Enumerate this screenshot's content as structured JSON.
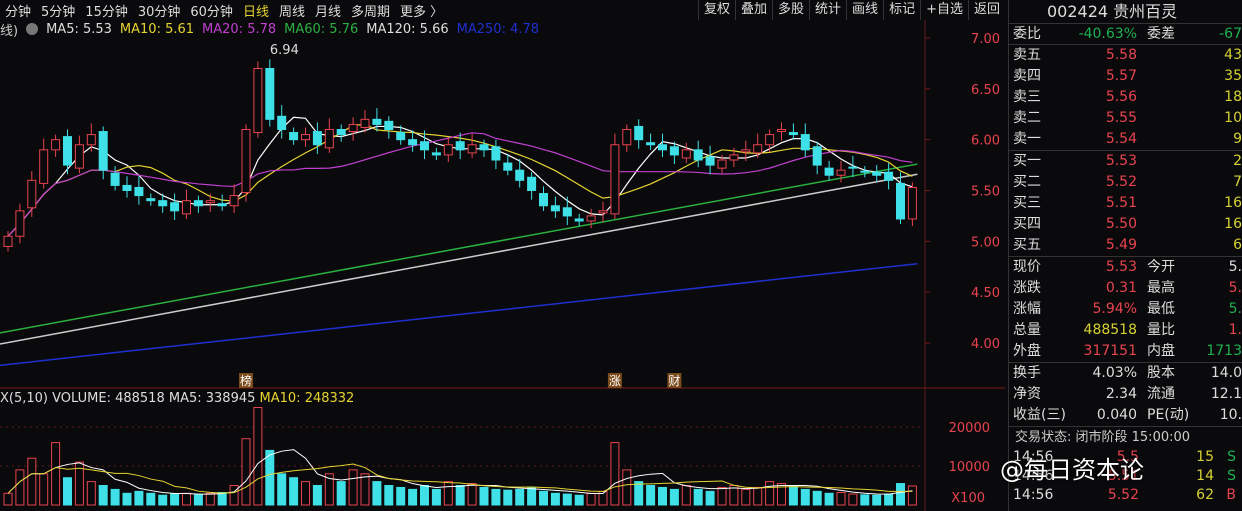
{
  "periods": [
    "分钟",
    "5分钟",
    "15分钟",
    "30分钟",
    "60分钟",
    "日线",
    "周线",
    "月线",
    "多周期",
    "更多 〉"
  ],
  "active_period": "日线",
  "tools": [
    "复权",
    "叠加",
    "多股",
    "统计",
    "画线",
    "标记",
    "+自选",
    "返回"
  ],
  "ma_header": {
    "prefix": "线)",
    "items": [
      {
        "label": "MA5: 5.53",
        "color": "#dddddd"
      },
      {
        "label": "MA10: 5.61",
        "color": "#e6d431"
      },
      {
        "label": "MA20: 5.78",
        "color": "#c040d0"
      },
      {
        "label": "MA60: 5.76",
        "color": "#2ab040"
      },
      {
        "label": "MA120: 5.66",
        "color": "#dddddd"
      },
      {
        "label": "MA250: 4.78",
        "color": "#2030d0"
      }
    ]
  },
  "price_labels": [
    "7.00",
    "6.50",
    "6.00",
    "5.50",
    "5.00",
    "4.50",
    "4.00"
  ],
  "high_label": "6.94",
  "markers": [
    {
      "text": "榜",
      "i": 20
    },
    {
      "text": "涨",
      "i": 51
    },
    {
      "text": "财",
      "i": 56
    }
  ],
  "volume_header": {
    "prefix": "X(5,10)",
    "volume": "VOLUME: 488518",
    "ma5": "MA5: 338945",
    "ma10": "MA10: 248332"
  },
  "volume_labels": [
    "20000",
    "10000",
    "X100"
  ],
  "chart_data": {
    "type": "candlestick",
    "ylim": [
      3.8,
      7.1
    ],
    "closes": [
      5.05,
      5.3,
      5.6,
      5.9,
      6.0,
      5.75,
      5.95,
      6.05,
      5.7,
      5.55,
      5.5,
      5.45,
      5.4,
      5.35,
      5.3,
      5.4,
      5.35,
      5.4,
      5.35,
      5.45,
      6.1,
      6.7,
      6.2,
      6.1,
      6.0,
      6.05,
      5.95,
      6.1,
      6.05,
      6.15,
      6.2,
      6.15,
      6.1,
      6.0,
      5.95,
      5.9,
      5.85,
      5.95,
      5.9,
      5.95,
      5.9,
      5.8,
      5.7,
      5.6,
      5.5,
      5.35,
      5.3,
      5.25,
      5.2,
      5.25,
      5.3,
      5.95,
      6.1,
      6.0,
      5.95,
      5.9,
      5.85,
      5.9,
      5.8,
      5.75,
      5.8,
      5.85,
      5.9,
      5.95,
      6.05,
      6.1,
      6.05,
      5.9,
      5.75,
      5.65,
      5.7,
      5.72,
      5.68,
      5.65,
      5.6,
      5.22,
      5.53
    ],
    "volumes": [
      3000,
      9000,
      12000,
      8000,
      16000,
      7000,
      11000,
      6000,
      5000,
      4000,
      3000,
      3500,
      3000,
      2500,
      2800,
      3000,
      2600,
      3000,
      3200,
      5000,
      17000,
      25000,
      14000,
      8000,
      7000,
      6000,
      5000,
      8000,
      6000,
      9000,
      8000,
      6000,
      5000,
      4500,
      4000,
      5000,
      4000,
      6000,
      5000,
      5500,
      4500,
      4000,
      3800,
      4000,
      4500,
      3500,
      3000,
      2800,
      2500,
      3000,
      3500,
      16000,
      9000,
      6000,
      5000,
      4500,
      4000,
      5000,
      4000,
      3500,
      4500,
      5000,
      4000,
      4500,
      6000,
      5500,
      5000,
      4000,
      3500,
      3000,
      3200,
      2800,
      2600,
      2500,
      2800,
      5500,
      4885
    ],
    "ma60": [
      4.1,
      5.76
    ],
    "ma120": [
      3.99,
      5.66
    ],
    "ma250": [
      3.78,
      4.78
    ]
  },
  "quote": {
    "code_name": "002424 贵州百灵",
    "wb_label": "委比",
    "wb": "-40.63%",
    "wc_label": "委差",
    "wc": "-67",
    "sells": [
      {
        "l": "卖五",
        "p": "5.58",
        "q": "43"
      },
      {
        "l": "卖四",
        "p": "5.57",
        "q": "35"
      },
      {
        "l": "卖三",
        "p": "5.56",
        "q": "18"
      },
      {
        "l": "卖二",
        "p": "5.55",
        "q": "10"
      },
      {
        "l": "卖一",
        "p": "5.54",
        "q": "9"
      }
    ],
    "buys": [
      {
        "l": "买一",
        "p": "5.53",
        "q": "2"
      },
      {
        "l": "买二",
        "p": "5.52",
        "q": "7"
      },
      {
        "l": "买三",
        "p": "5.51",
        "q": "16"
      },
      {
        "l": "买四",
        "p": "5.50",
        "q": "16"
      },
      {
        "l": "买五",
        "p": "5.49",
        "q": "6"
      }
    ],
    "stats": [
      {
        "l": "现价",
        "v": "5.53",
        "c": "red",
        "l2": "今开",
        "v2": "5.",
        "c2": "wht"
      },
      {
        "l": "涨跌",
        "v": "0.31",
        "c": "red",
        "l2": "最高",
        "v2": "5.",
        "c2": "red"
      },
      {
        "l": "涨幅",
        "v": "5.94%",
        "c": "red",
        "l2": "最低",
        "v2": "5.",
        "c2": "grn"
      },
      {
        "l": "总量",
        "v": "488518",
        "c": "yel",
        "l2": "量比",
        "v2": "1.",
        "c2": "red"
      },
      {
        "l": "外盘",
        "v": "317151",
        "c": "red",
        "l2": "内盘",
        "v2": "1713",
        "c2": "grn"
      }
    ],
    "stats2": [
      {
        "l": "换手",
        "v": "4.03%",
        "l2": "股本",
        "v2": "14.0"
      },
      {
        "l": "净资",
        "v": "2.34",
        "l2": "流通",
        "v2": "12.1"
      },
      {
        "l": "收益(三)",
        "v": "0.040",
        "l2": "PE(动)",
        "v2": "10."
      }
    ],
    "status": "交易状态: 闭市阶段 15:00:00",
    "ticks": [
      {
        "t": "14:56",
        "p": "5.5",
        "q": "15",
        "s": "S"
      },
      {
        "t": "14:56",
        "p": "5.51",
        "q": "14",
        "s": "S"
      },
      {
        "t": "14:56",
        "p": "5.52",
        "q": "62",
        "s": "B"
      }
    ]
  },
  "watermark": "@每日资本论"
}
